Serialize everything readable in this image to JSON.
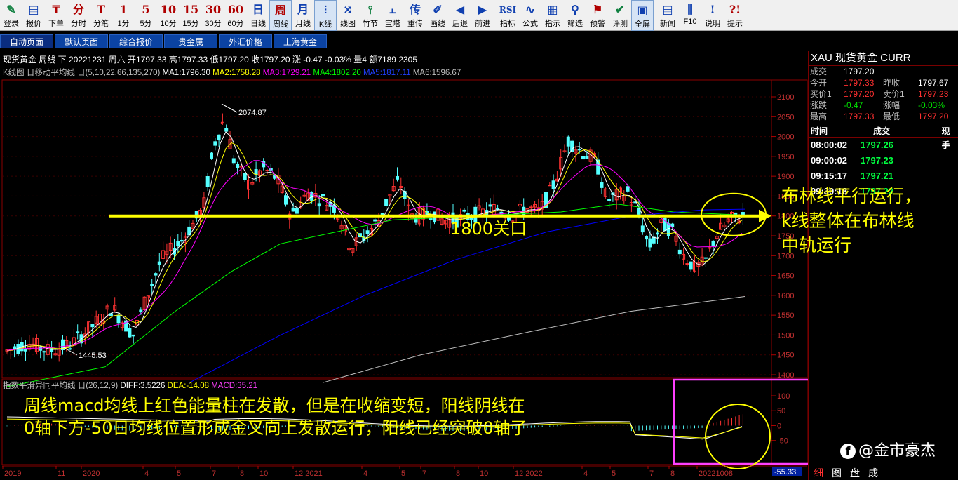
{
  "toolbar": [
    {
      "name": "login",
      "icon": "✎",
      "label": "登录",
      "color": "green"
    },
    {
      "name": "quote",
      "icon": "▤",
      "label": "报价",
      "color": "blue"
    },
    {
      "name": "order",
      "icon": "₸",
      "label": "下单",
      "color": "red"
    },
    {
      "name": "timeshare",
      "icon": "分",
      "label": "分时",
      "color": "red"
    },
    {
      "name": "tick",
      "icon": "T",
      "label": "分笔",
      "color": "red"
    },
    {
      "name": "m1",
      "icon": "1",
      "label": "1分",
      "color": "red"
    },
    {
      "name": "m5",
      "icon": "5",
      "label": "5分",
      "color": "red"
    },
    {
      "name": "m10",
      "icon": "10",
      "label": "10分",
      "color": "red"
    },
    {
      "name": "m15",
      "icon": "15",
      "label": "15分",
      "color": "red"
    },
    {
      "name": "m30",
      "icon": "30",
      "label": "30分",
      "color": "red"
    },
    {
      "name": "m60",
      "icon": "60",
      "label": "60分",
      "color": "red"
    },
    {
      "name": "daily",
      "icon": "日",
      "label": "日线",
      "color": "blue"
    },
    {
      "name": "weekly",
      "icon": "周",
      "label": "周线",
      "color": "red",
      "active": true
    },
    {
      "name": "monthly",
      "icon": "月",
      "label": "月线",
      "color": "blue"
    },
    {
      "name": "kline",
      "icon": "⫶",
      "label": "K线",
      "color": "blue",
      "active": true
    },
    {
      "name": "linechart",
      "icon": "⤨",
      "label": "线图",
      "color": "blue"
    },
    {
      "name": "bamboo",
      "icon": "⫯",
      "label": "竹节",
      "color": "green"
    },
    {
      "name": "tower",
      "icon": "⫠",
      "label": "宝塔",
      "color": "blue"
    },
    {
      "name": "redraw",
      "icon": "传",
      "label": "重传",
      "color": "blue"
    },
    {
      "name": "drawline",
      "icon": "✐",
      "label": "画线",
      "color": "blue"
    },
    {
      "name": "back",
      "icon": "◀",
      "label": "后退",
      "color": "blue"
    },
    {
      "name": "forward",
      "icon": "▶",
      "label": "前进",
      "color": "blue"
    },
    {
      "name": "indicator",
      "icon": "RSI",
      "label": "指标",
      "color": "blue"
    },
    {
      "name": "formula",
      "icon": "∿",
      "label": "公式",
      "color": "blue"
    },
    {
      "name": "guide",
      "icon": "▦",
      "label": "指示",
      "color": "blue"
    },
    {
      "name": "filter",
      "icon": "⚲",
      "label": "筛选",
      "color": "blue"
    },
    {
      "name": "alert",
      "icon": "⚑",
      "label": "预警",
      "color": "red"
    },
    {
      "name": "evaluate",
      "icon": "✔",
      "label": "评测",
      "color": "green"
    },
    {
      "name": "fullscreen",
      "icon": "▣",
      "label": "全屏",
      "color": "blue",
      "active": true
    },
    {
      "name": "news",
      "icon": "▤",
      "label": "新闻",
      "color": "blue"
    },
    {
      "name": "f10",
      "icon": "⫼",
      "label": "F10",
      "color": "blue"
    },
    {
      "name": "help",
      "icon": "!",
      "label": "说明",
      "color": "blue"
    },
    {
      "name": "hint",
      "icon": "?!",
      "label": "提示",
      "color": "red"
    }
  ],
  "tabs": [
    "自动页面",
    "默认页面",
    "综合报价",
    "贵金属",
    "外汇价格",
    "上海黄金"
  ],
  "info_line": "现货黄金 周线 下 20221231 周六 开1797.33 高1797.33 低1797.20 收1797.20 涨 -0.47 -0.03% 量4 额7189 2305",
  "ma_line": {
    "prefix": "K线图 日移动平均线 日(5,10,22,66,135,270)",
    "ma1": "MA1:1796.30",
    "ma2": "MA2:1758.28",
    "ma3": "MA3:1729.21",
    "ma4": "MA4:1802.20",
    "ma5": "MA5:1817.11",
    "ma6": "MA6:1596.67"
  },
  "macd_line": {
    "prefix": "指数平滑异同平均线 日(26,12,9)",
    "diff": "DIFF:3.5226",
    "dea": "DEA:-14.08",
    "macd": "MACD:35.21"
  },
  "price_axis": [
    "2100",
    "2050",
    "2000",
    "1950",
    "1900",
    "1850",
    "1800",
    "1750",
    "1700",
    "1650",
    "1600",
    "1550",
    "1500",
    "1450",
    "1400"
  ],
  "macd_axis": [
    "100",
    "50",
    "0",
    "-50"
  ],
  "macd_low_label": "-55.33",
  "date_axis": [
    "2019",
    "11",
    "2020",
    "4",
    "5",
    "7",
    "8",
    "10",
    "12 2021",
    "4",
    "5",
    "7",
    "8",
    "10",
    "12 2022",
    "4",
    "5",
    "7",
    "8",
    "20221008"
  ],
  "high_label": "2074.87",
  "low_label": "1445.53",
  "right_panel": {
    "title": "XAU  现货黄金    CURR",
    "rows": [
      {
        "l1": "成交",
        "v1": "1797.20",
        "l2": "",
        "v2": ""
      },
      {
        "l1": "今开",
        "v1": "1797.33",
        "l2": "昨收",
        "v2": "1797.67"
      },
      {
        "l1": "买价1",
        "v1": "1797.20",
        "l2": "卖价1",
        "v2": "1797.23"
      },
      {
        "l1": "涨跌",
        "v1": "-0.47",
        "l2": "涨幅",
        "v2": "-0.03%"
      },
      {
        "l1": "最高",
        "v1": "1797.33",
        "l2": "最低",
        "v2": "1797.20"
      }
    ],
    "ticks_header": [
      "时间",
      "成交",
      "现手"
    ],
    "ticks": [
      {
        "time": "08:00:02",
        "price": "1797.26"
      },
      {
        "time": "09:00:02",
        "price": "1797.23"
      },
      {
        "time": "09:15:17",
        "price": "1797.21"
      },
      {
        "time": "09:30:18",
        "price": "1797.22"
      }
    ]
  },
  "annotations": {
    "right": [
      "布林线平行运行，",
      "k线整体在布林线",
      "中轨运行"
    ],
    "bottom": [
      "周线macd均线上红色能量柱在发散，但是在收缩变短，阳线阴线在",
      "0轴下方-50日均线位置形成金叉向上发散运行，阳线已经突破0轴了"
    ],
    "level": "1800关口"
  },
  "watermark": "@金市豪杰",
  "bottom_tabs": [
    "细",
    "图",
    "盘",
    "成"
  ],
  "colors": {
    "up": "#ff3232",
    "down": "#54ffff",
    "ma1": "#ffffff",
    "ma2": "#ffff00",
    "ma3": "#ff00ff",
    "ma4": "#00ff00",
    "ma5": "#0000ff",
    "ma6": "#c0c0c0",
    "annotation": "#ffff00",
    "magenta_box": "#ff40ff"
  }
}
